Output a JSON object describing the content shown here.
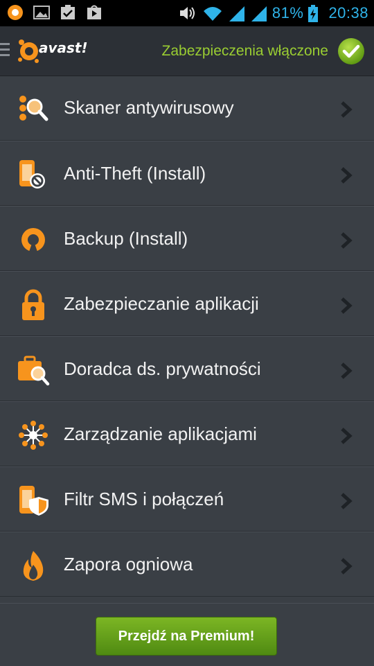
{
  "status_bar": {
    "battery_percent": "81%",
    "time": "20:38",
    "icons_left": [
      "avast-notification-icon",
      "image-icon",
      "clipboard-check-icon",
      "play-store-icon"
    ],
    "icons_right": [
      "volume-icon",
      "wifi-icon",
      "signal-icon",
      "signal-icon",
      "battery-charging-icon"
    ],
    "accent_color": "#2fb3e9"
  },
  "header": {
    "logo_text": "avast!",
    "protection_status": "Zabezpieczenia włączone",
    "status_color": "#9acd32"
  },
  "menu": {
    "items": [
      {
        "label": "Skaner antywirusowy",
        "icon": "scan-magnifier-icon"
      },
      {
        "label": "Anti-Theft (Install)",
        "icon": "phone-blocked-icon"
      },
      {
        "label": "Backup (Install)",
        "icon": "backup-refresh-icon"
      },
      {
        "label": "Zabezpieczanie aplikacji",
        "icon": "padlock-icon"
      },
      {
        "label": "Doradca ds. prywatności",
        "icon": "briefcase-magnifier-icon"
      },
      {
        "label": "Zarządzanie aplikacjami",
        "icon": "network-nodes-icon"
      },
      {
        "label": "Filtr SMS i połączeń",
        "icon": "phone-shield-icon"
      },
      {
        "label": "Zapora ogniowa",
        "icon": "flame-icon"
      }
    ]
  },
  "footer": {
    "premium_button": "Przejdź na Premium!"
  },
  "colors": {
    "background": "#3a3f45",
    "accent_orange": "#f7941d",
    "button_green": "#6aa61d"
  }
}
